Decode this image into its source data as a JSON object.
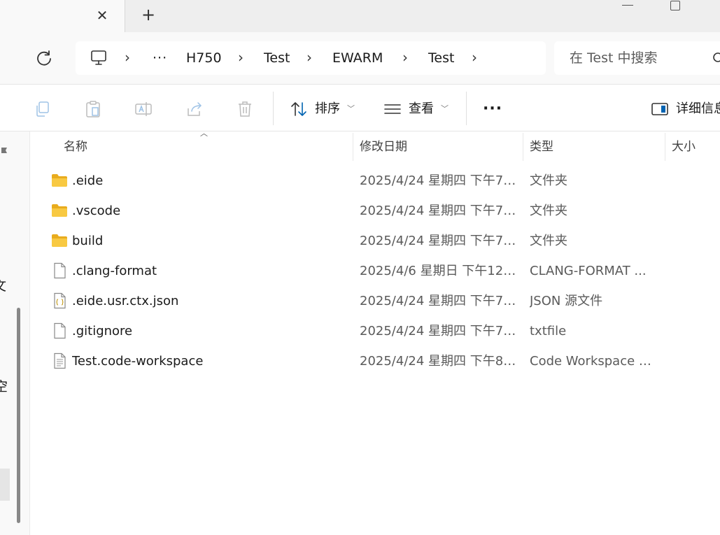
{
  "window": {
    "new_tab_glyph": "+",
    "close_tab_glyph": "✕"
  },
  "address": {
    "more_glyph": "···",
    "crumbs": [
      "H750",
      "Test",
      "EWARM",
      "Test"
    ],
    "search_placeholder": "在 Test 中搜索"
  },
  "toolbar": {
    "sort_label": "排序",
    "view_label": "查看",
    "more_glyph": "···",
    "details_label": "详细信息"
  },
  "nav": {
    "fragments": [
      "文",
      "空"
    ]
  },
  "columns": {
    "name": "名称",
    "date": "修改日期",
    "type": "类型",
    "size": "大小"
  },
  "files": [
    {
      "name": ".eide",
      "date": "2025/4/24 星期四 下午7:...",
      "type": "文件夹",
      "icon": "folder-icon"
    },
    {
      "name": ".vscode",
      "date": "2025/4/24 星期四 下午7:...",
      "type": "文件夹",
      "icon": "folder-icon"
    },
    {
      "name": "build",
      "date": "2025/4/24 星期四 下午7:...",
      "type": "文件夹",
      "icon": "folder-icon"
    },
    {
      "name": ".clang-format",
      "date": "2025/4/6 星期日 下午12:...",
      "type": "CLANG-FORMAT ...",
      "icon": "file-icon"
    },
    {
      "name": ".eide.usr.ctx.json",
      "date": "2025/4/24 星期四 下午7:...",
      "type": "JSON 源文件",
      "icon": "json-file-icon"
    },
    {
      "name": ".gitignore",
      "date": "2025/4/24 星期四 下午7:...",
      "type": "txtfile",
      "icon": "file-icon"
    },
    {
      "name": "Test.code-workspace",
      "date": "2025/4/24 星期四 下午8:...",
      "type": "Code Workspace 源...",
      "icon": "text-file-icon"
    }
  ],
  "colors": {
    "folder": "#f8c942",
    "folder_dark": "#e9ac1e",
    "accent": "#0063b1"
  }
}
